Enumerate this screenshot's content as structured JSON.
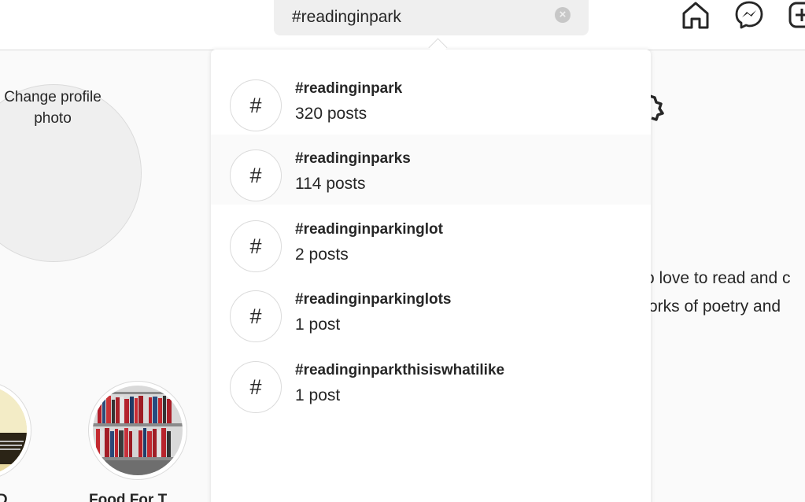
{
  "search": {
    "value": "#readinginpark",
    "clear_icon": "×"
  },
  "nav": {
    "icons": [
      "home-icon",
      "messenger-icon",
      "new-post-icon"
    ]
  },
  "profile": {
    "change_photo": "Change profile photo",
    "bio_line_1": "o love to read and c",
    "bio_line_2": "orks of poetry and",
    "highlights": [
      {
        "label": "e D"
      },
      {
        "label": "Food For T"
      }
    ]
  },
  "dropdown": {
    "results": [
      {
        "symbol": "#",
        "tag": "#readinginpark",
        "count": "320 posts"
      },
      {
        "symbol": "#",
        "tag": "#readinginparks",
        "count": "114 posts"
      },
      {
        "symbol": "#",
        "tag": "#readinginparkinglot",
        "count": "2 posts"
      },
      {
        "symbol": "#",
        "tag": "#readinginparkinglots",
        "count": "1 post"
      },
      {
        "symbol": "#",
        "tag": "#readinginparkthisiswhatilike",
        "count": "1 post"
      }
    ]
  },
  "colors": {
    "text": "#262626",
    "border": "#dbdbdb",
    "search_bg": "#efefef",
    "hover_bg": "#fafafa"
  }
}
